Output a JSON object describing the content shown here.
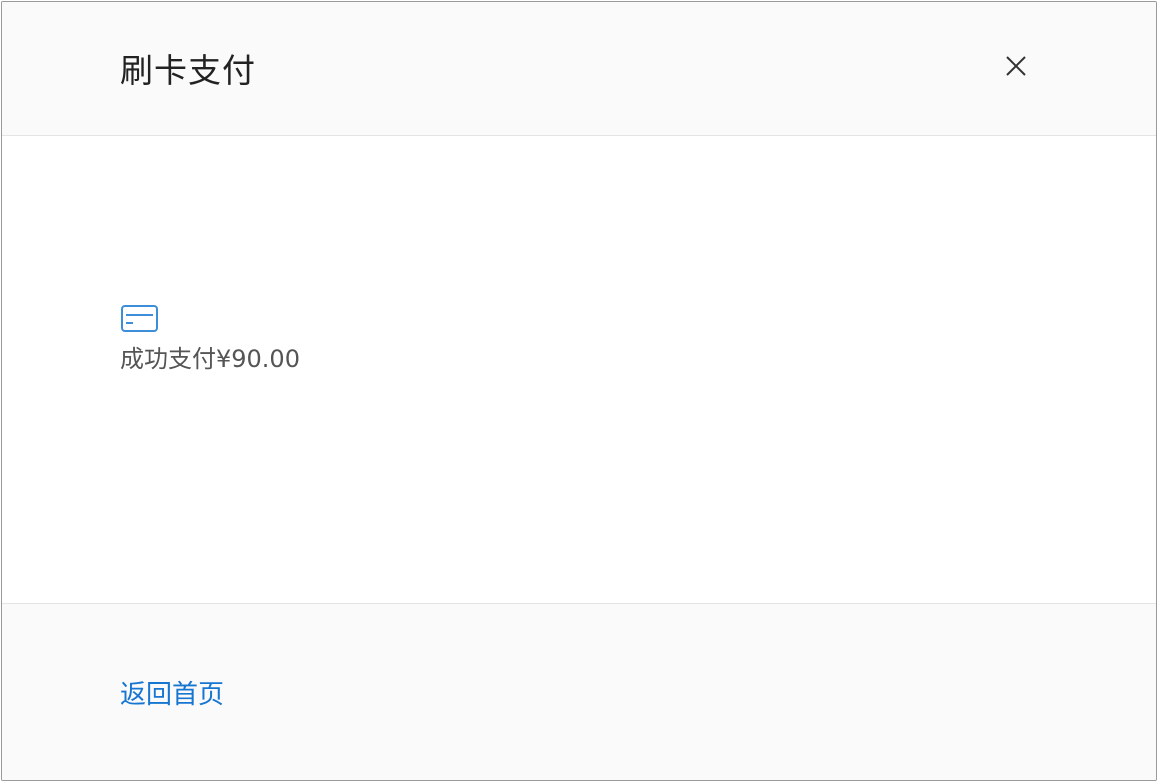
{
  "dialog": {
    "title": "刷卡支付",
    "close_icon": "close-icon"
  },
  "body": {
    "icon": "credit-card-icon",
    "message": "成功支付¥90.00"
  },
  "footer": {
    "home_link": "返回首页"
  },
  "colors": {
    "accent": "#1776d2",
    "icon": "#3d8ed8",
    "text": "#222222",
    "secondary_text": "#555555"
  }
}
